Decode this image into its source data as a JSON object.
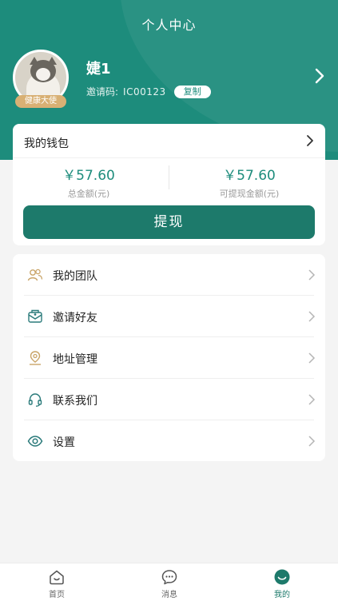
{
  "header": {
    "title": "个人中心"
  },
  "profile": {
    "name": "婕1",
    "badge": "健康大使",
    "invite_label": "邀请码:",
    "invite_code": "IC00123",
    "copy_label": "复制"
  },
  "wallet": {
    "title": "我的钱包",
    "total": {
      "value": "￥57.60",
      "label": "总金额(元)"
    },
    "withdrawable": {
      "value": "￥57.60",
      "label": "可提现金额(元)"
    },
    "withdraw_label": "提现"
  },
  "menu": {
    "items": [
      {
        "label": "我的团队",
        "icon": "team-icon"
      },
      {
        "label": "邀请好友",
        "icon": "invite-friend-icon"
      },
      {
        "label": "地址管理",
        "icon": "location-icon"
      },
      {
        "label": "联系我们",
        "icon": "headset-icon"
      },
      {
        "label": "设置",
        "icon": "settings-eye-icon"
      }
    ]
  },
  "tabbar": {
    "tabs": [
      {
        "label": "首页",
        "icon": "home-icon"
      },
      {
        "label": "消息",
        "icon": "message-icon"
      },
      {
        "label": "我的",
        "icon": "profile-icon",
        "active": true
      }
    ]
  },
  "colors": {
    "brand": "#1d8c7c",
    "button": "#1d7a6b",
    "badge": "#d8b074",
    "icon_gold": "#c9a468",
    "icon_teal": "#2a7a7a"
  }
}
